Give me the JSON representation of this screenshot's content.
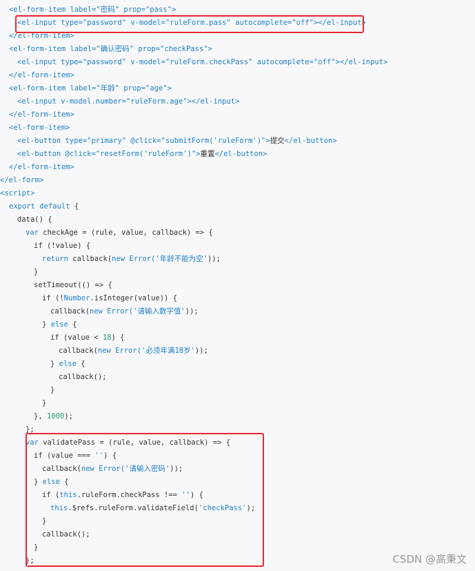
{
  "colors": {
    "tag": "#1e7fc8",
    "attr": "#1e7fc8",
    "keyword": "#1e7fc8",
    "string": "#1e7fc8",
    "number": "#1a9c6b",
    "text": "#333333",
    "highlight": "#e8262d",
    "watermark": "#999999"
  },
  "code_lines": [
    [
      {
        "t": "<el-form-item ",
        "c": "tag"
      },
      {
        "t": "label=",
        "c": "attr"
      },
      {
        "t": "\"密码\"",
        "c": "string"
      },
      {
        "t": " prop=",
        "c": "attr"
      },
      {
        "t": "\"pass\"",
        "c": "string"
      },
      {
        "t": ">",
        "c": "tag"
      }
    ],
    [
      {
        "t": "<el-input ",
        "c": "tag"
      },
      {
        "t": "type=",
        "c": "attr"
      },
      {
        "t": "\"password\"",
        "c": "string"
      },
      {
        "t": " v-model=",
        "c": "attr"
      },
      {
        "t": "\"ruleForm.pass\"",
        "c": "string"
      },
      {
        "t": " autocomplete=",
        "c": "attr"
      },
      {
        "t": "\"off\"",
        "c": "string"
      },
      {
        "t": "></el-input>",
        "c": "tag"
      }
    ],
    [
      {
        "t": "</el-form-item>",
        "c": "tag"
      }
    ],
    [
      {
        "t": "<el-form-item ",
        "c": "tag"
      },
      {
        "t": "label=",
        "c": "attr"
      },
      {
        "t": "\"确认密码\"",
        "c": "string"
      },
      {
        "t": " prop=",
        "c": "attr"
      },
      {
        "t": "\"checkPass\"",
        "c": "string"
      },
      {
        "t": ">",
        "c": "tag"
      }
    ],
    [
      {
        "t": "<el-input ",
        "c": "tag"
      },
      {
        "t": "type=",
        "c": "attr"
      },
      {
        "t": "\"password\"",
        "c": "string"
      },
      {
        "t": " v-model=",
        "c": "attr"
      },
      {
        "t": "\"ruleForm.checkPass\"",
        "c": "string"
      },
      {
        "t": " autocomplete=",
        "c": "attr"
      },
      {
        "t": "\"off\"",
        "c": "string"
      },
      {
        "t": "></el-input>",
        "c": "tag"
      }
    ],
    [
      {
        "t": "</el-form-item>",
        "c": "tag"
      }
    ],
    [
      {
        "t": "<el-form-item ",
        "c": "tag"
      },
      {
        "t": "label=",
        "c": "attr"
      },
      {
        "t": "\"年龄\"",
        "c": "string"
      },
      {
        "t": " prop=",
        "c": "attr"
      },
      {
        "t": "\"age\"",
        "c": "string"
      },
      {
        "t": ">",
        "c": "tag"
      }
    ],
    [
      {
        "t": "<el-input ",
        "c": "tag"
      },
      {
        "t": "v-model.number=",
        "c": "attr"
      },
      {
        "t": "\"ruleForm.age\"",
        "c": "string"
      },
      {
        "t": "></el-input>",
        "c": "tag"
      }
    ],
    [
      {
        "t": "</el-form-item>",
        "c": "tag"
      }
    ],
    [
      {
        "t": "<el-form-item>",
        "c": "tag"
      }
    ],
    [
      {
        "t": "<el-button ",
        "c": "tag"
      },
      {
        "t": "type=",
        "c": "attr"
      },
      {
        "t": "\"primary\"",
        "c": "string"
      },
      {
        "t": " @click=",
        "c": "attr"
      },
      {
        "t": "\"submitForm('ruleForm')\"",
        "c": "string"
      },
      {
        "t": ">",
        "c": "tag"
      },
      {
        "t": "提交",
        "c": "text"
      },
      {
        "t": "</el-button>",
        "c": "tag"
      }
    ],
    [
      {
        "t": "<el-button ",
        "c": "tag"
      },
      {
        "t": "@click=",
        "c": "attr"
      },
      {
        "t": "\"resetForm('ruleForm')\"",
        "c": "string"
      },
      {
        "t": ">",
        "c": "tag"
      },
      {
        "t": "重置",
        "c": "text"
      },
      {
        "t": "</el-button>",
        "c": "tag"
      }
    ],
    [
      {
        "t": "</el-form-item>",
        "c": "tag"
      }
    ],
    [
      {
        "t": "</el-form>",
        "c": "tag"
      }
    ],
    [
      {
        "t": "<script>",
        "c": "tag"
      }
    ],
    [
      {
        "t": "export default",
        "c": "keyword"
      },
      {
        "t": " {",
        "c": "text"
      }
    ],
    [
      {
        "t": "data() {",
        "c": "text"
      }
    ],
    [
      {
        "t": "var",
        "c": "keyword"
      },
      {
        "t": " checkAge = (rule, value, callback) => {",
        "c": "text"
      }
    ],
    [
      {
        "t": "if (!value) {",
        "c": "text"
      }
    ],
    [
      {
        "t": "return",
        "c": "keyword"
      },
      {
        "t": " callback(",
        "c": "text"
      },
      {
        "t": "new Error(",
        "c": "keyword"
      },
      {
        "t": "'年龄不能为空'",
        "c": "string"
      },
      {
        "t": "));",
        "c": "text"
      }
    ],
    [
      {
        "t": "}",
        "c": "text"
      }
    ],
    [
      {
        "t": "setTimeout(() => {",
        "c": "text"
      }
    ],
    [
      {
        "t": "if (!",
        "c": "text"
      },
      {
        "t": "Number",
        "c": "keyword"
      },
      {
        "t": ".isInteger(value)) {",
        "c": "text"
      }
    ],
    [
      {
        "t": "callback(",
        "c": "text"
      },
      {
        "t": "new Error(",
        "c": "keyword"
      },
      {
        "t": "'请输入数字值'",
        "c": "string"
      },
      {
        "t": "));",
        "c": "text"
      }
    ],
    [
      {
        "t": "} ",
        "c": "text"
      },
      {
        "t": "else",
        "c": "keyword"
      },
      {
        "t": " {",
        "c": "text"
      }
    ],
    [
      {
        "t": "if (value < ",
        "c": "text"
      },
      {
        "t": "18",
        "c": "number"
      },
      {
        "t": ") {",
        "c": "text"
      }
    ],
    [
      {
        "t": "callback(",
        "c": "text"
      },
      {
        "t": "new Error(",
        "c": "keyword"
      },
      {
        "t": "'必须年满18岁'",
        "c": "string"
      },
      {
        "t": "));",
        "c": "text"
      }
    ],
    [
      {
        "t": "} ",
        "c": "text"
      },
      {
        "t": "else",
        "c": "keyword"
      },
      {
        "t": " {",
        "c": "text"
      }
    ],
    [
      {
        "t": "callback();",
        "c": "text"
      }
    ],
    [
      {
        "t": "}",
        "c": "text"
      }
    ],
    [
      {
        "t": "}",
        "c": "text"
      }
    ],
    [
      {
        "t": "}, ",
        "c": "text"
      },
      {
        "t": "1000",
        "c": "number"
      },
      {
        "t": ");",
        "c": "text"
      }
    ],
    [
      {
        "t": "};",
        "c": "text"
      }
    ],
    [
      {
        "t": "var",
        "c": "keyword"
      },
      {
        "t": " validatePass = (rule, value, callback) => {",
        "c": "text"
      }
    ],
    [
      {
        "t": "if (value === ",
        "c": "text"
      },
      {
        "t": "''",
        "c": "string"
      },
      {
        "t": ") {",
        "c": "text"
      }
    ],
    [
      {
        "t": "callback(",
        "c": "text"
      },
      {
        "t": "new Error(",
        "c": "keyword"
      },
      {
        "t": "'请输入密码'",
        "c": "string"
      },
      {
        "t": "));",
        "c": "text"
      }
    ],
    [
      {
        "t": "} ",
        "c": "text"
      },
      {
        "t": "else",
        "c": "keyword"
      },
      {
        "t": " {",
        "c": "text"
      }
    ],
    [
      {
        "t": "if (",
        "c": "text"
      },
      {
        "t": "this",
        "c": "keyword"
      },
      {
        "t": ".ruleForm.checkPass !== ",
        "c": "text"
      },
      {
        "t": "''",
        "c": "string"
      },
      {
        "t": ") {",
        "c": "text"
      }
    ],
    [
      {
        "t": "this",
        "c": "keyword"
      },
      {
        "t": ".$refs.ruleForm.validateField(",
        "c": "text"
      },
      {
        "t": "'checkPass'",
        "c": "string"
      },
      {
        "t": ");",
        "c": "text"
      }
    ],
    [
      {
        "t": "}",
        "c": "text"
      }
    ],
    [
      {
        "t": "callback();",
        "c": "text"
      }
    ],
    [
      {
        "t": "}",
        "c": "text"
      }
    ],
    [
      {
        "t": "};",
        "c": "text"
      }
    ]
  ],
  "watermark": {
    "text": "CSDN @高秉文"
  }
}
